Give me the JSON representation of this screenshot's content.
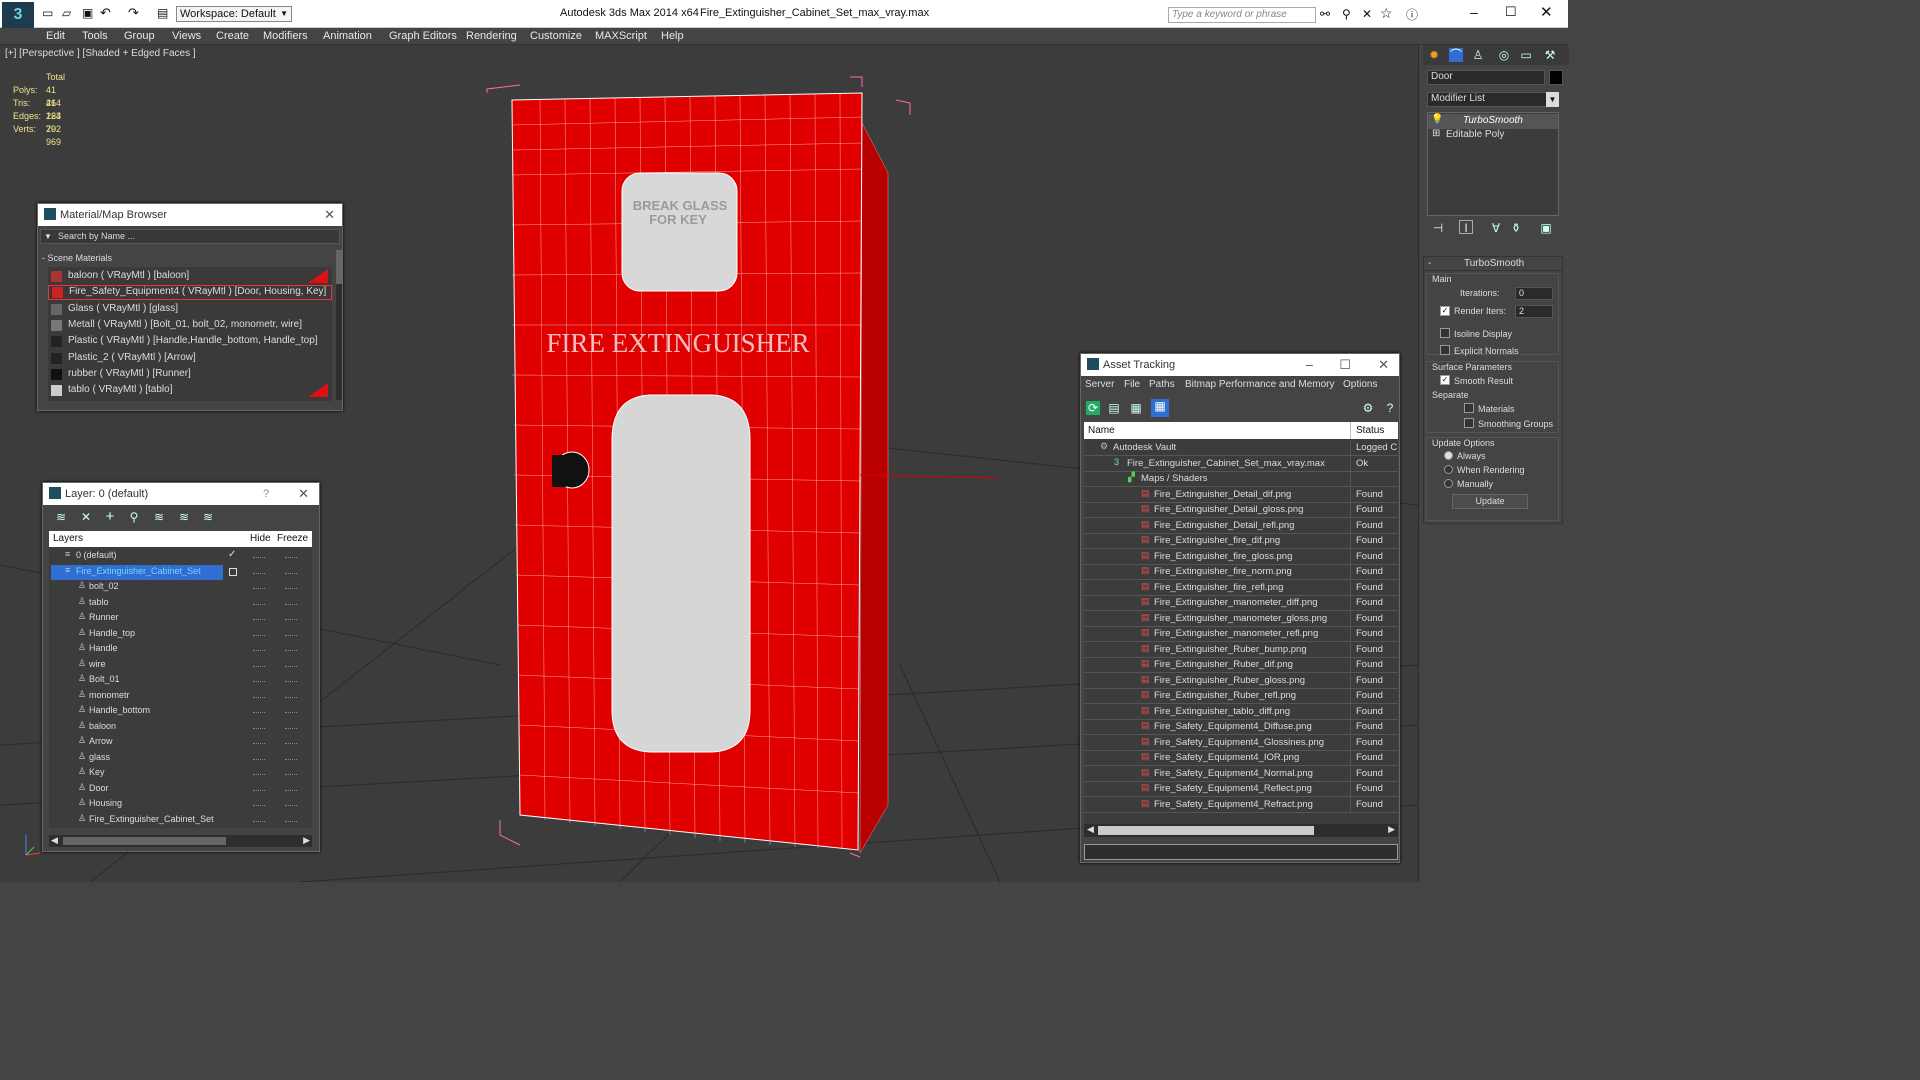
{
  "title": {
    "app": "Autodesk 3ds Max  2014 x64",
    "file": "Fire_Extinguisher_Cabinet_Set_max_vray.max",
    "workspace": "Workspace: Default",
    "search_placeholder": "Type a keyword or phrase"
  },
  "menu": [
    "Edit",
    "Tools",
    "Group",
    "Views",
    "Create",
    "Modifiers",
    "Animation",
    "Graph Editors",
    "Rendering",
    "Customize",
    "MAXScript",
    "Help"
  ],
  "viewport": {
    "label": "[+] [Perspective ] [Shaded + Edged Faces ]",
    "stats": {
      "header": "Total",
      "polys_label": "Polys:",
      "polys": "41 264",
      "tris_label": "Tris:",
      "tris": "41 264",
      "edges_label": "Edges:",
      "edges": "123 792",
      "verts_label": "Verts:",
      "verts": "20 969"
    },
    "cabinet_text": {
      "break_glass": "BREAK GLASS",
      "for_key": "FOR KEY",
      "fire_ext": "FIRE EXTINGUISHER"
    }
  },
  "material_browser": {
    "title": "Material/Map Browser",
    "search_placeholder": "Search by Name ...",
    "section": "- Scene Materials",
    "items": [
      "baloon  ( VRayMtl ) [baloon]",
      "Fire_Safety_Equipment4  ( VRayMtl ) [Door, Housing, Key]",
      "Glass  ( VRayMtl ) [glass]",
      "Metall  ( VRayMtl ) [Bolt_01, bolt_02, monometr, wire]",
      "Plastic  ( VRayMtl ) [Handle,Handle_bottom, Handle_top]",
      "Plastic_2  ( VRayMtl ) [Arrow]",
      "rubber  ( VRayMtl ) [Runner]",
      "tablo  ( VRayMtl ) [tablo]"
    ]
  },
  "layer_panel": {
    "title": "Layer: 0 (default)",
    "help": "?",
    "col_layers": "Layers",
    "col_hide": "Hide",
    "col_freeze": "Freeze",
    "rows": [
      "0 (default)",
      "Fire_Extinguisher_Cabinet_Set",
      "bolt_02",
      "tablo",
      "Runner",
      "Handle_top",
      "Handle",
      "wire",
      "Bolt_01",
      "monometr",
      "Handle_bottom",
      "baloon",
      "Arrow",
      "glass",
      "Key",
      "Door",
      "Housing",
      "Fire_Extinguisher_Cabinet_Set"
    ]
  },
  "asset_tracking": {
    "title": "Asset Tracking",
    "menu": [
      "Server",
      "File",
      "Paths",
      "Bitmap Performance and Memory",
      "Options"
    ],
    "col_name": "Name",
    "col_status": "Status",
    "rows": [
      {
        "name": "Autodesk Vault",
        "status": "Logged C"
      },
      {
        "name": "Fire_Extinguisher_Cabinet_Set_max_vray.max",
        "status": "Ok"
      },
      {
        "name": "Maps / Shaders",
        "status": ""
      },
      {
        "name": "Fire_Extinguisher_Detail_dif.png",
        "status": "Found"
      },
      {
        "name": "Fire_Extinguisher_Detail_gloss.png",
        "status": "Found"
      },
      {
        "name": "Fire_Extinguisher_Detail_refl.png",
        "status": "Found"
      },
      {
        "name": "Fire_Extinguisher_fire_dif.png",
        "status": "Found"
      },
      {
        "name": "Fire_Extinguisher_fire_gloss.png",
        "status": "Found"
      },
      {
        "name": "Fire_Extinguisher_fire_norm.png",
        "status": "Found"
      },
      {
        "name": "Fire_Extinguisher_fire_refl.png",
        "status": "Found"
      },
      {
        "name": "Fire_Extinguisher_manometer_diff.png",
        "status": "Found"
      },
      {
        "name": "Fire_Extinguisher_manometer_gloss.png",
        "status": "Found"
      },
      {
        "name": "Fire_Extinguisher_manometer_refl.png",
        "status": "Found"
      },
      {
        "name": "Fire_Extinguisher_Ruber_bump.png",
        "status": "Found"
      },
      {
        "name": "Fire_Extinguisher_Ruber_dif.png",
        "status": "Found"
      },
      {
        "name": "Fire_Extinguisher_Ruber_gloss.png",
        "status": "Found"
      },
      {
        "name": "Fire_Extinguisher_Ruber_refl.png",
        "status": "Found"
      },
      {
        "name": "Fire_Extinguisher_tablo_diff.png",
        "status": "Found"
      },
      {
        "name": "Fire_Safety_Equipment4_Diffuse.png",
        "status": "Found"
      },
      {
        "name": "Fire_Safety_Equipment4_Glossines.png",
        "status": "Found"
      },
      {
        "name": "Fire_Safety_Equipment4_IOR.png",
        "status": "Found"
      },
      {
        "name": "Fire_Safety_Equipment4_Normal.png",
        "status": "Found"
      },
      {
        "name": "Fire_Safety_Equipment4_Reflect.png",
        "status": "Found"
      },
      {
        "name": "Fire_Safety_Equipment4_Refract.png",
        "status": "Found"
      }
    ]
  },
  "command_panel": {
    "object_name": "Door",
    "modifier_list": "Modifier List",
    "stack": [
      "TurboSmooth",
      "Editable Poly"
    ],
    "rollout_title": "TurboSmooth",
    "main": "Main",
    "iterations_label": "Iterations:",
    "iterations": "0",
    "render_iters_label": "Render Iters:",
    "render_iters": "2",
    "isoline": "Isoline Display",
    "explicit_normals": "Explicit Normals",
    "surface_params": "Surface Parameters",
    "smooth_result": "Smooth Result",
    "separate": "Separate",
    "materials": "Materials",
    "smoothing_groups": "Smoothing Groups",
    "update_options": "Update Options",
    "always": "Always",
    "when_rendering": "When Rendering",
    "manually": "Manually",
    "update_btn": "Update"
  },
  "colors": {
    "accent": "#2f6fd1",
    "cabinet_red": "#e00000",
    "wire": "#ffffff",
    "selection_box": "#ff6aa8"
  }
}
